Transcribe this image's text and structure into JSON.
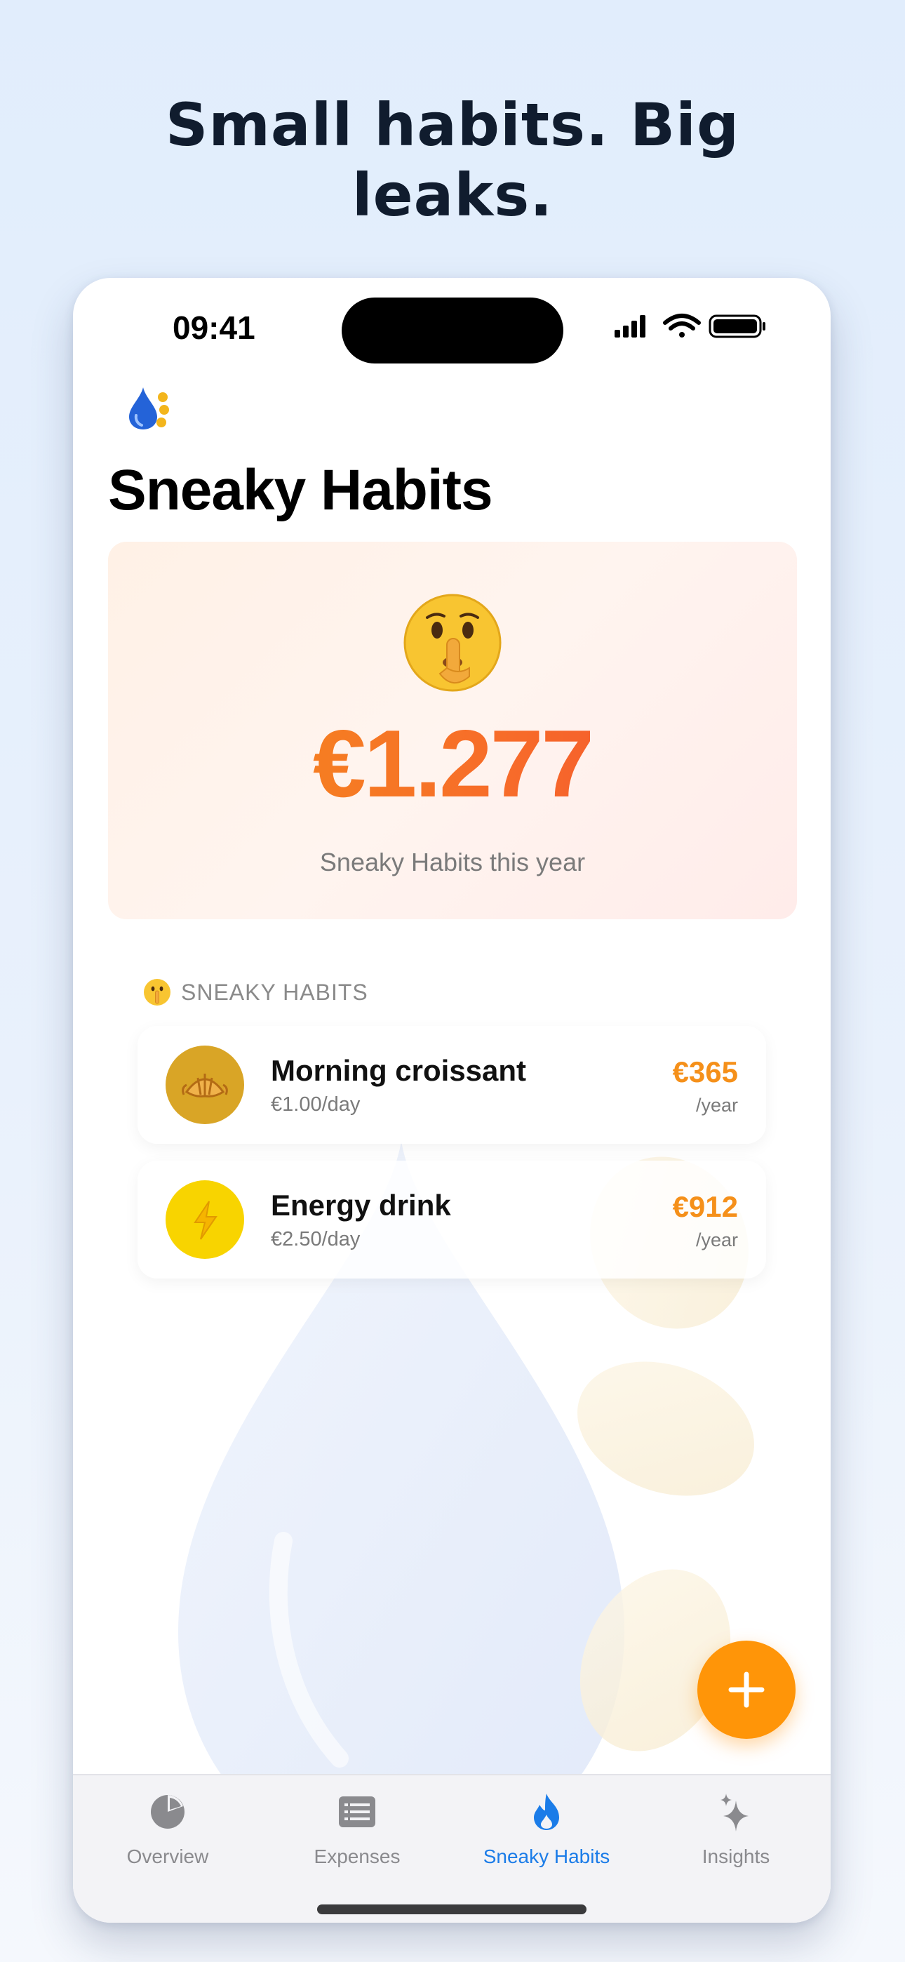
{
  "headline": {
    "line1": "Small habits. Big",
    "line2": "leaks."
  },
  "status_bar": {
    "time": "09:41",
    "icons": [
      "signal-icon",
      "wifi-icon",
      "battery-icon"
    ]
  },
  "app": {
    "logo_icon": "water-drop-coins-icon",
    "page_title": "Sneaky Habits"
  },
  "summary": {
    "emoji": "shushing-face-icon",
    "amount": "€1.277",
    "label": "Sneaky Habits this year"
  },
  "habits_section": {
    "emoji": "shushing-face-icon",
    "title": "SNEAKY HABITS",
    "items": [
      {
        "name": "Morning croissant",
        "rate": "€1.00/day",
        "amount": "€365",
        "period": "/year",
        "icon": "croissant-icon",
        "icon_color": "#d9a526"
      },
      {
        "name": "Energy drink",
        "rate": "€2.50/day",
        "amount": "€912",
        "period": "/year",
        "icon": "lightning-icon",
        "icon_color": "#f8d400"
      }
    ]
  },
  "fab": {
    "icon": "plus-icon"
  },
  "tab_bar": {
    "tabs": [
      {
        "label": "Overview",
        "icon": "pie-chart-icon",
        "active": false
      },
      {
        "label": "Expenses",
        "icon": "list-icon",
        "active": false
      },
      {
        "label": "Sneaky Habits",
        "icon": "flame-icon",
        "active": true
      },
      {
        "label": "Insights",
        "icon": "sparkles-icon",
        "active": false
      }
    ]
  },
  "colors": {
    "accent_orange": "#f5901a",
    "accent_red": "#f24b2f",
    "fab_orange": "#ff9508",
    "active_tab_blue": "#1b7ce8",
    "headline_navy": "#101c2e"
  }
}
